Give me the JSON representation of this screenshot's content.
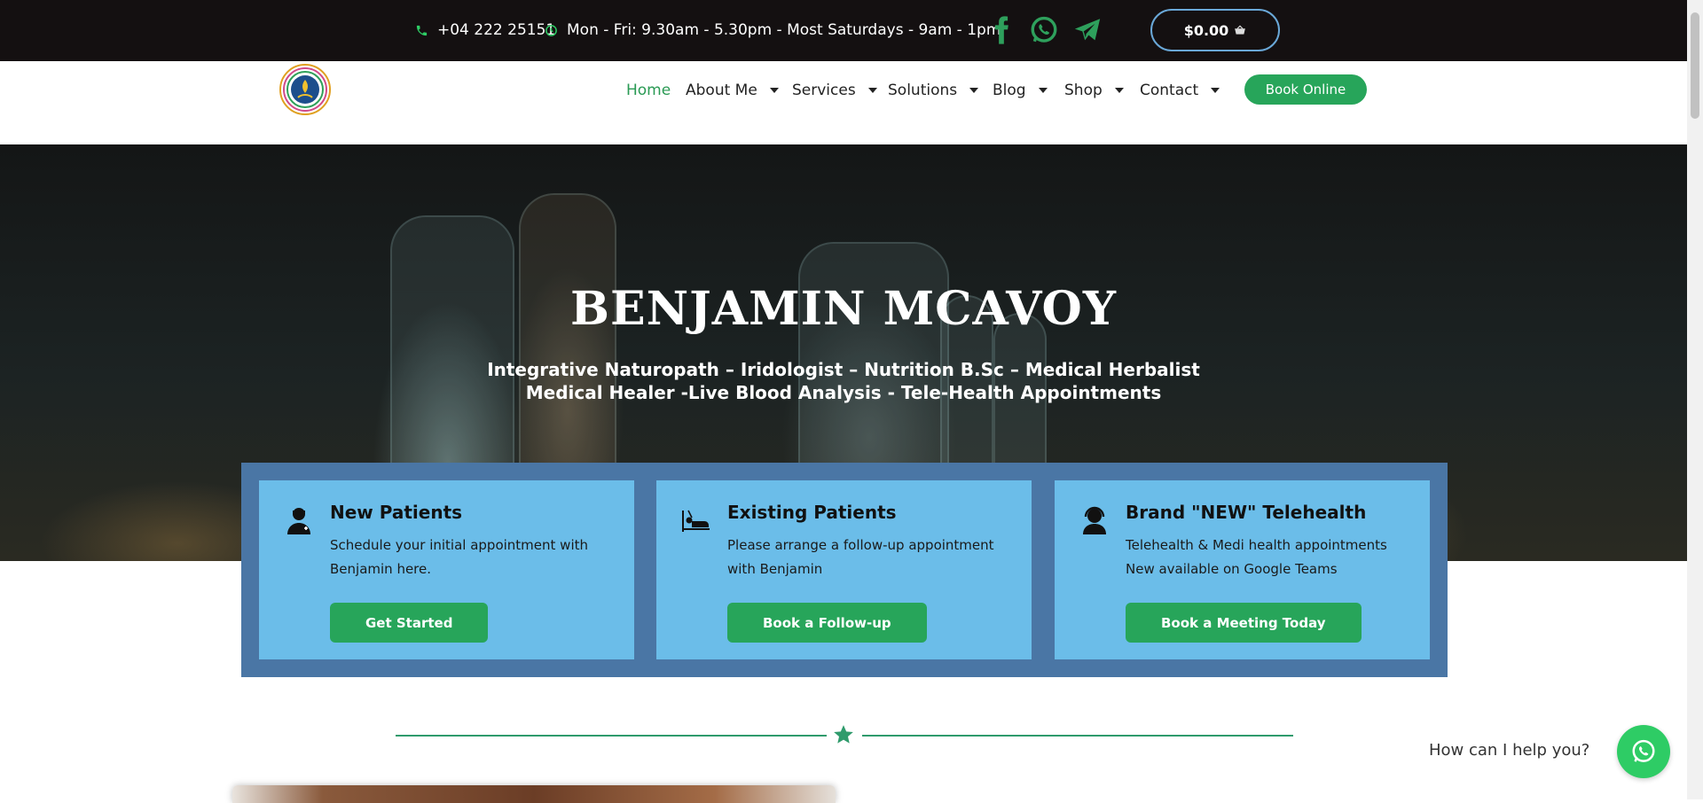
{
  "topbar": {
    "phone": "+04 222 25151",
    "hours": "Mon - Fri: 9.30am - 5.30pm - Most Saturdays - 9am - 1pm",
    "cart_total": "$0.00",
    "social": [
      "facebook-icon",
      "whatsapp-icon",
      "telegram-icon"
    ]
  },
  "nav": {
    "items": [
      {
        "label": "Home",
        "active": true
      },
      {
        "label": "About Me"
      },
      {
        "label": "Services"
      },
      {
        "label": "Solutions"
      },
      {
        "label": "Blog"
      },
      {
        "label": "Shop"
      },
      {
        "label": "Contact"
      }
    ],
    "book_online": "Book Online"
  },
  "hero": {
    "title": "BENJAMIN MCAVOY",
    "subtitle_line1": "Integrative Naturopath – Iridologist – Nutrition B.Sc – Medical Herbalist",
    "subtitle_line2": "Medical Healer -Live Blood Analysis - Tele-Health Appointments"
  },
  "cards": [
    {
      "title": "New Patients",
      "desc": "Schedule your initial appointment with Benjamin here.",
      "button": "Get Started",
      "icon": "doctor-icon"
    },
    {
      "title": "Existing Patients",
      "desc": "Please arrange a follow-up appointment with Benjamin",
      "button": "Book a Follow-up",
      "icon": "patient-bed-icon"
    },
    {
      "title": "Brand \"NEW\" Telehealth",
      "desc": "Telehealth & Medi health appointments New available on Google Teams",
      "button": "Book a Meeting Today",
      "icon": "user-headset-icon"
    }
  ],
  "chat": {
    "prompt": "How can I help you?"
  },
  "colors": {
    "accent_green": "#27a55a",
    "topbar_bg": "#141011",
    "card_bg": "#6bbde9",
    "panel_bg": "#4a76a5"
  }
}
